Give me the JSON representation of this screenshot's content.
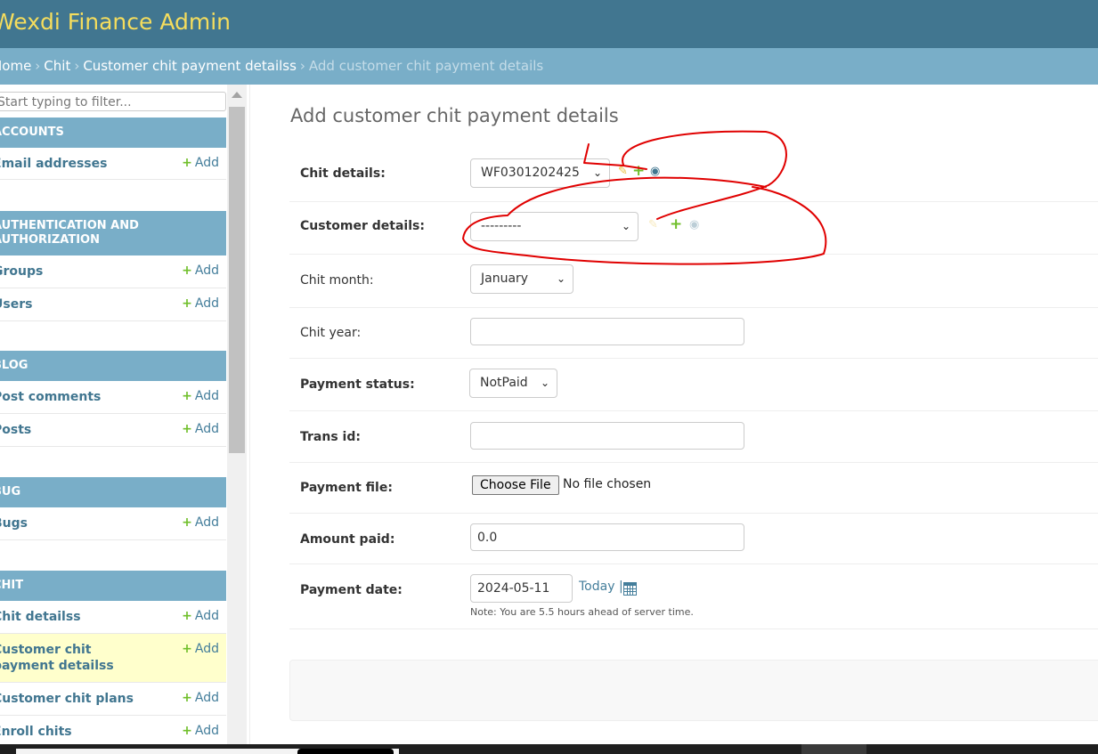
{
  "branding": "Wexdi Finance Admin",
  "breadcrumbs": {
    "home": "Home",
    "chit": "Chit",
    "model": "Customer chit payment detailss",
    "current": "Add customer chit payment details",
    "sep": "›"
  },
  "sidebar": {
    "filter_placeholder": "Start typing to filter...",
    "add_label": "Add",
    "modules": [
      {
        "caption": "ACCOUNTS",
        "items": [
          "Email addresses"
        ]
      },
      {
        "caption": "AUTHENTICATION AND AUTHORIZATION",
        "items": [
          "Groups",
          "Users"
        ]
      },
      {
        "caption": "BLOG",
        "items": [
          "Post comments",
          "Posts"
        ]
      },
      {
        "caption": "BUG",
        "items": [
          "Bugs"
        ]
      },
      {
        "caption": "CHIT",
        "items": [
          "Chit detailss",
          "Customer chit payment detailss",
          "Customer chit plans",
          "Enroll chits"
        ]
      }
    ],
    "selected_item": "Customer chit payment detailss"
  },
  "form": {
    "title": "Add customer chit payment details",
    "fields": {
      "chit_details": {
        "label": "Chit details:",
        "value": "WF0301202425"
      },
      "customer_details": {
        "label": "Customer details:",
        "value": "---------"
      },
      "chit_month": {
        "label": "Chit month:",
        "value": "January"
      },
      "chit_year": {
        "label": "Chit year:",
        "value": ""
      },
      "payment_status": {
        "label": "Payment status:",
        "value": "NotPaid"
      },
      "trans_id": {
        "label": "Trans id:",
        "value": ""
      },
      "payment_file": {
        "label": "Payment file:",
        "button": "Choose File",
        "status": "No file chosen"
      },
      "amount_paid": {
        "label": "Amount paid:",
        "value": "0.0"
      },
      "payment_date": {
        "label": "Payment date:",
        "value": "2024-05-11",
        "today": "Today",
        "today_sep": "|",
        "note": "Note: You are 5.5 hours ahead of server time."
      }
    }
  },
  "icons": {
    "pencil": "pencil-icon",
    "plus": "add-icon",
    "eye": "view-icon",
    "calendar": "calendar-icon"
  },
  "colors": {
    "header": "#417690",
    "branding": "#f5dd5d",
    "breadcrumbs": "#79aec8",
    "annotation": "#e00000"
  }
}
